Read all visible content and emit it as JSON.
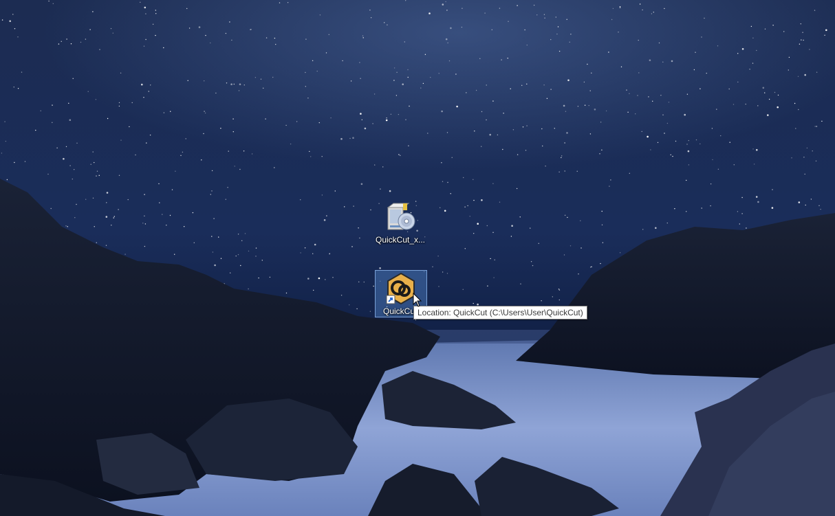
{
  "desktop": {
    "icons": [
      {
        "label": "QuickCut_x...",
        "icon": "installer-icon"
      },
      {
        "label": "QuickCut",
        "icon": "quickcut-app-icon",
        "is_shortcut": true,
        "selected": true
      }
    ],
    "tooltip": "Location: QuickCut (C:\\Users\\User\\QuickCut)"
  },
  "colors": {
    "sky_top": "#1b2a4e",
    "sky_bottom": "#0a1430",
    "selection": "#5082c8",
    "icon_gold": "#e8b04a"
  }
}
